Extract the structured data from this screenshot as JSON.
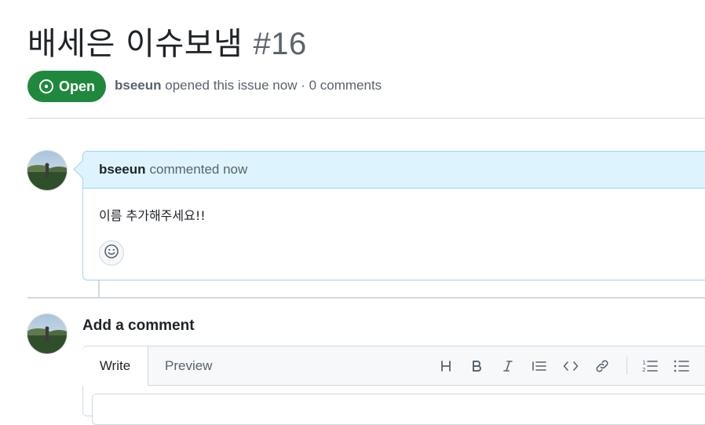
{
  "issue": {
    "title": "배세은 이슈보냄",
    "number": "#16",
    "state": "Open",
    "author": "bseeun",
    "meta_text": "opened this issue now · 0 comments"
  },
  "comment": {
    "author": "bseeun",
    "time_text": "commented now",
    "body": "이름 추가해주세요!!"
  },
  "new_comment": {
    "heading": "Add a comment",
    "tabs": [
      {
        "label": "Write",
        "active": true
      },
      {
        "label": "Preview",
        "active": false
      }
    ],
    "toolbar_icons": [
      "heading-icon",
      "bold-icon",
      "italic-icon",
      "quote-icon",
      "code-icon",
      "link-icon",
      "ordered-list-icon",
      "unordered-list-icon"
    ]
  },
  "colors": {
    "open_green": "#1f883d",
    "comment_header_bg": "#ddf4ff",
    "comment_border": "#9fd2f0",
    "border": "#d1d9e0",
    "muted_text": "#59636e"
  }
}
